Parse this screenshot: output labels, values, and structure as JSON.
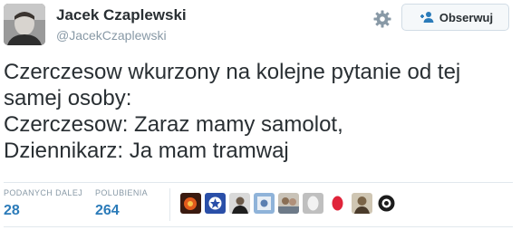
{
  "user": {
    "name": "Jacek Czaplewski",
    "handle": "@JacekCzaplewski"
  },
  "follow_button": {
    "label": "Obserwuj"
  },
  "tweet": {
    "lines": [
      "Czerczesow wkurzony na kolejne pytanie od tej",
      "samej osoby:",
      "Czerczesow: Zaraz mamy samolot,",
      "Dziennikarz: Ja mam tramwaj"
    ]
  },
  "stats": {
    "retweets_label": "PODANYCH DALEJ",
    "retweets_value": "28",
    "likes_label": "POLUBIENIA",
    "likes_value": "264"
  },
  "colors": {
    "link": "#2b7bb9",
    "muted": "#8899a6",
    "text": "#292f33"
  },
  "icons": {
    "settings": "gear-icon",
    "follow": "add-user-icon"
  },
  "likers_count_shown": 10
}
